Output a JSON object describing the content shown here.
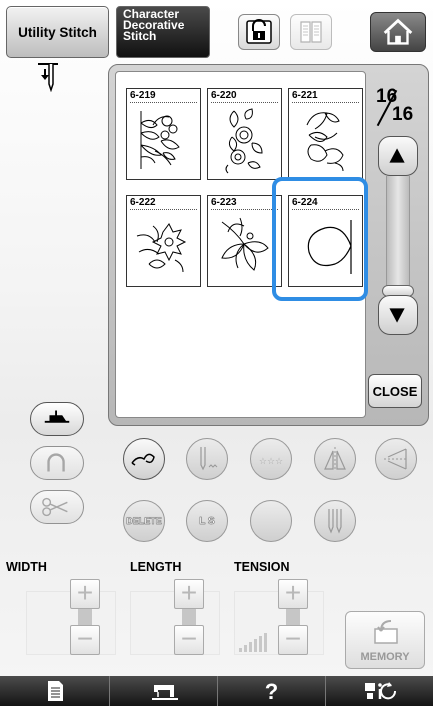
{
  "tabs": {
    "utility_label": "Utility Stitch",
    "character_label": [
      "Character",
      "Decorative",
      "Stitch"
    ]
  },
  "stitch_grid": [
    {
      "number": "6-219",
      "icon": "floral-stitch-219"
    },
    {
      "number": "6-220",
      "icon": "floral-stitch-220"
    },
    {
      "number": "6-221",
      "icon": "floral-stitch-221"
    },
    {
      "number": "6-222",
      "icon": "floral-stitch-222"
    },
    {
      "number": "6-223",
      "icon": "floral-stitch-223"
    },
    {
      "number": "6-224",
      "icon": "circle-stitch-224",
      "selected": true
    }
  ],
  "page": {
    "current": "16",
    "total": "16"
  },
  "close_label": "CLOSE",
  "edit_buttons": {
    "delete_label": "DELETE",
    "ls_label": "L S"
  },
  "settings": {
    "width_label": "WIDTH",
    "length_label": "LENGTH",
    "tension_label": "TENSION",
    "plus": "+",
    "minus": "−"
  },
  "memory_label": "MEMORY",
  "bottom_bar": {
    "help_label": "?",
    "icons": [
      "page-icon",
      "sewing-machine-icon",
      "help-icon",
      "settings-icon"
    ]
  },
  "colors": {
    "selection": "#2f8de4",
    "bottom_bar": "#1f1f1f"
  }
}
